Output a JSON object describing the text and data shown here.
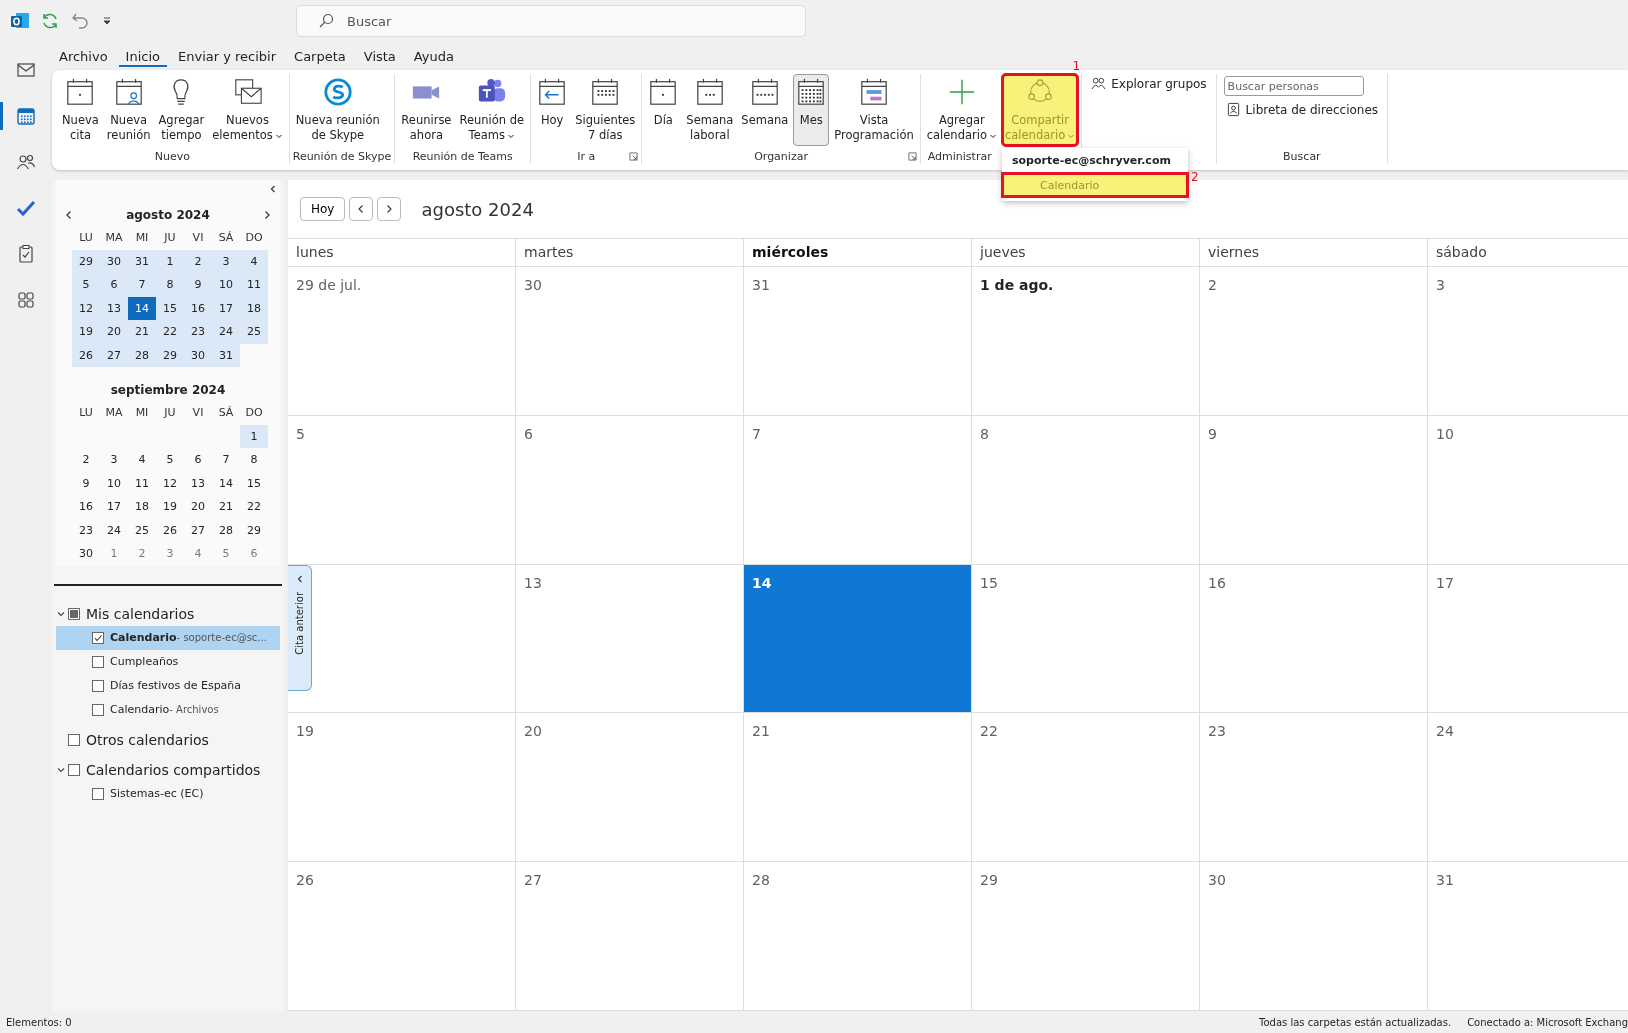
{
  "topbar": {
    "search": {
      "placeholder": "Buscar"
    }
  },
  "rail": [
    {
      "kind": "mail",
      "selected": false
    },
    {
      "kind": "calendar",
      "selected": true
    },
    {
      "kind": "people",
      "selected": false
    },
    {
      "kind": "todo",
      "selected": false
    },
    {
      "kind": "clipboard",
      "selected": false
    },
    {
      "kind": "apps",
      "selected": false
    }
  ],
  "tabs": [
    {
      "label": "Archivo",
      "selected": false
    },
    {
      "label": "Inicio",
      "selected": true
    },
    {
      "label": "Enviar y recibir",
      "selected": false
    },
    {
      "label": "Carpeta",
      "selected": false
    },
    {
      "label": "Vista",
      "selected": false
    },
    {
      "label": "Ayuda",
      "selected": false
    }
  ],
  "ribbon": {
    "groups": [
      {
        "label": "Nuevo",
        "launcher": false,
        "buttons": [
          {
            "kind": "calendar-dot",
            "lines": [
              "Nueva",
              "cita"
            ],
            "dropdown": false,
            "selected": false,
            "highlighted": false
          },
          {
            "kind": "calendar-person",
            "lines": [
              "Nueva",
              "reunión"
            ],
            "dropdown": false,
            "selected": false,
            "highlighted": false
          },
          {
            "kind": "bulb",
            "lines": [
              "Agregar",
              "tiempo"
            ],
            "dropdown": false,
            "selected": false,
            "highlighted": false
          },
          {
            "kind": "new-items",
            "lines": [
              "Nuevos",
              "elementos"
            ],
            "dropdown": true,
            "selected": false,
            "highlighted": false
          }
        ]
      },
      {
        "label": "Reunión de Skype",
        "launcher": false,
        "buttons": [
          {
            "kind": "skype",
            "lines": [
              "Nueva reunión",
              "de Skype"
            ],
            "dropdown": false,
            "selected": false,
            "highlighted": false
          }
        ]
      },
      {
        "label": "Reunión de Teams",
        "launcher": false,
        "buttons": [
          {
            "kind": "video",
            "lines": [
              "Reunirse",
              "ahora"
            ],
            "dropdown": false,
            "selected": false,
            "highlighted": false
          },
          {
            "kind": "teams",
            "lines": [
              "Reunión de",
              "Teams"
            ],
            "dropdown": true,
            "selected": false,
            "highlighted": false
          }
        ]
      },
      {
        "label": "Ir a",
        "launcher": true,
        "buttons": [
          {
            "kind": "calendar-arrow",
            "lines": [
              "Hoy"
            ],
            "dropdown": false,
            "selected": false,
            "highlighted": false
          },
          {
            "kind": "calendar-grid-small",
            "lines": [
              "Siguientes",
              "7 días"
            ],
            "dropdown": false,
            "selected": false,
            "highlighted": false
          }
        ]
      },
      {
        "label": "Organizar",
        "launcher": true,
        "buttons": [
          {
            "kind": "calendar-dot",
            "lines": [
              "Día"
            ],
            "dropdown": false,
            "selected": false,
            "highlighted": false
          },
          {
            "kind": "calendar-3dots",
            "lines": [
              "Semana",
              "laboral"
            ],
            "dropdown": false,
            "selected": false,
            "highlighted": false
          },
          {
            "kind": "calendar-5dots",
            "lines": [
              "Semana"
            ],
            "dropdown": false,
            "selected": false,
            "highlighted": false
          },
          {
            "kind": "calendar-grid",
            "lines": [
              "Mes"
            ],
            "dropdown": false,
            "selected": true,
            "highlighted": false
          },
          {
            "kind": "calendar-schedule",
            "lines": [
              "Vista",
              "Programación"
            ],
            "dropdown": false,
            "selected": false,
            "highlighted": false
          }
        ]
      },
      {
        "label": "Administrar",
        "launcher": false,
        "buttons": [
          {
            "kind": "plus",
            "lines": [
              "Agregar",
              "calendario"
            ],
            "dropdown": true,
            "selected": false,
            "highlighted": false
          },
          {
            "kind": "share",
            "lines": [
              "Compartir",
              "calendario"
            ],
            "dropdown": true,
            "selected": false,
            "highlighted": true
          }
        ]
      },
      {
        "buttons": [
          {
            "kind": "group",
            "label": "Explorar grupos"
          }
        ]
      },
      {
        "label": "Buscar",
        "launcher": false,
        "buttons": [
          {
            "kind": "field",
            "placeholder": "Buscar personas"
          },
          {
            "kind": "address-book",
            "label": "Libreta de direcciones"
          }
        ]
      }
    ]
  },
  "share_menu": {
    "header": "soporte-ec@schryver.com",
    "items": [
      {
        "label": "Calendario",
        "highlighted": true
      }
    ]
  },
  "annotations": [
    {
      "label": "1"
    },
    {
      "label": "2"
    }
  ],
  "mini_calendars": [
    {
      "title": "agosto 2024",
      "weekdays": [
        "LU",
        "MA",
        "MI",
        "JU",
        "VI",
        "SÁ",
        "DO"
      ],
      "weeks": [
        [
          {
            "d": "29",
            "in_view": true,
            "today": false,
            "muted": false
          },
          {
            "d": "30",
            "in_view": true,
            "today": false,
            "muted": false
          },
          {
            "d": "31",
            "in_view": true,
            "today": false,
            "muted": false
          },
          {
            "d": "1",
            "in_view": true,
            "today": false,
            "muted": false
          },
          {
            "d": "2",
            "in_view": true,
            "today": false,
            "muted": false
          },
          {
            "d": "3",
            "in_view": true,
            "today": false,
            "muted": false
          },
          {
            "d": "4",
            "in_view": true,
            "today": false,
            "muted": false
          }
        ],
        [
          {
            "d": "5",
            "in_view": true,
            "today": false,
            "muted": false
          },
          {
            "d": "6",
            "in_view": true,
            "today": false,
            "muted": false
          },
          {
            "d": "7",
            "in_view": true,
            "today": false,
            "muted": false
          },
          {
            "d": "8",
            "in_view": true,
            "today": false,
            "muted": false
          },
          {
            "d": "9",
            "in_view": true,
            "today": false,
            "muted": false
          },
          {
            "d": "10",
            "in_view": true,
            "today": false,
            "muted": false
          },
          {
            "d": "11",
            "in_view": true,
            "today": false,
            "muted": false
          }
        ],
        [
          {
            "d": "12",
            "in_view": true,
            "today": false,
            "muted": false
          },
          {
            "d": "13",
            "in_view": true,
            "today": false,
            "muted": false
          },
          {
            "d": "14",
            "in_view": true,
            "today": true,
            "muted": false
          },
          {
            "d": "15",
            "in_view": true,
            "today": false,
            "muted": false
          },
          {
            "d": "16",
            "in_view": true,
            "today": false,
            "muted": false
          },
          {
            "d": "17",
            "in_view": true,
            "today": false,
            "muted": false
          },
          {
            "d": "18",
            "in_view": true,
            "today": false,
            "muted": false
          }
        ],
        [
          {
            "d": "19",
            "in_view": true,
            "today": false,
            "muted": false
          },
          {
            "d": "20",
            "in_view": true,
            "today": false,
            "muted": false
          },
          {
            "d": "21",
            "in_view": true,
            "today": false,
            "muted": false
          },
          {
            "d": "22",
            "in_view": true,
            "today": false,
            "muted": false
          },
          {
            "d": "23",
            "in_view": true,
            "today": false,
            "muted": false
          },
          {
            "d": "24",
            "in_view": true,
            "today": false,
            "muted": false
          },
          {
            "d": "25",
            "in_view": true,
            "today": false,
            "muted": false
          }
        ],
        [
          {
            "d": "26",
            "in_view": true,
            "today": false,
            "muted": false
          },
          {
            "d": "27",
            "in_view": true,
            "today": false,
            "muted": false
          },
          {
            "d": "28",
            "in_view": true,
            "today": false,
            "muted": false
          },
          {
            "d": "29",
            "in_view": true,
            "today": false,
            "muted": false
          },
          {
            "d": "30",
            "in_view": true,
            "today": false,
            "muted": false
          },
          {
            "d": "31",
            "in_view": true,
            "today": false,
            "muted": false
          }
        ]
      ]
    },
    {
      "title": "septiembre 2024",
      "weekdays": [
        "LU",
        "MA",
        "MI",
        "JU",
        "VI",
        "SÁ",
        "DO"
      ],
      "weeks": [
        [
          {
            "d": "1",
            "in_view": true,
            "today": false,
            "muted": false
          }
        ],
        [
          {
            "d": "2",
            "in_view": false,
            "today": false,
            "muted": false
          },
          {
            "d": "3",
            "in_view": false,
            "today": false,
            "muted": false
          },
          {
            "d": "4",
            "in_view": false,
            "today": false,
            "muted": false
          },
          {
            "d": "5",
            "in_view": false,
            "today": false,
            "muted": false
          },
          {
            "d": "6",
            "in_view": false,
            "today": false,
            "muted": false
          },
          {
            "d": "7",
            "in_view": false,
            "today": false,
            "muted": false
          },
          {
            "d": "8",
            "in_view": false,
            "today": false,
            "muted": false
          }
        ],
        [
          {
            "d": "9",
            "in_view": false,
            "today": false,
            "muted": false
          },
          {
            "d": "10",
            "in_view": false,
            "today": false,
            "muted": false
          },
          {
            "d": "11",
            "in_view": false,
            "today": false,
            "muted": false
          },
          {
            "d": "12",
            "in_view": false,
            "today": false,
            "muted": false
          },
          {
            "d": "13",
            "in_view": false,
            "today": false,
            "muted": false
          },
          {
            "d": "14",
            "in_view": false,
            "today": false,
            "muted": false
          },
          {
            "d": "15",
            "in_view": false,
            "today": false,
            "muted": false
          }
        ],
        [
          {
            "d": "16",
            "in_view": false,
            "today": false,
            "muted": false
          },
          {
            "d": "17",
            "in_view": false,
            "today": false,
            "muted": false
          },
          {
            "d": "18",
            "in_view": false,
            "today": false,
            "muted": false
          },
          {
            "d": "19",
            "in_view": false,
            "today": false,
            "muted": false
          },
          {
            "d": "20",
            "in_view": false,
            "today": false,
            "muted": false
          },
          {
            "d": "21",
            "in_view": false,
            "today": false,
            "muted": false
          },
          {
            "d": "22",
            "in_view": false,
            "today": false,
            "muted": false
          }
        ],
        [
          {
            "d": "23",
            "in_view": false,
            "today": false,
            "muted": false
          },
          {
            "d": "24",
            "in_view": false,
            "today": false,
            "muted": false
          },
          {
            "d": "25",
            "in_view": false,
            "today": false,
            "muted": false
          },
          {
            "d": "26",
            "in_view": false,
            "today": false,
            "muted": false
          },
          {
            "d": "27",
            "in_view": false,
            "today": false,
            "muted": false
          },
          {
            "d": "28",
            "in_view": false,
            "today": false,
            "muted": false
          },
          {
            "d": "29",
            "in_view": false,
            "today": false,
            "muted": false
          }
        ],
        [
          {
            "d": "30",
            "in_view": false,
            "today": false,
            "muted": false
          },
          {
            "d": "1",
            "in_view": false,
            "today": false,
            "muted": true
          },
          {
            "d": "2",
            "in_view": false,
            "today": false,
            "muted": true
          },
          {
            "d": "3",
            "in_view": false,
            "today": false,
            "muted": true
          },
          {
            "d": "4",
            "in_view": false,
            "today": false,
            "muted": true
          },
          {
            "d": "5",
            "in_view": false,
            "today": false,
            "muted": true
          },
          {
            "d": "6",
            "in_view": false,
            "today": false,
            "muted": true
          }
        ]
      ]
    }
  ],
  "calendar_groups": [
    {
      "label": "Mis calendarios",
      "checked": false,
      "mixed": true,
      "expanded": true,
      "children": [
        {
          "name": "Calendario",
          "detail": "- soporte-ec@sc...",
          "checked": true,
          "selected": true
        },
        {
          "name": "Cumpleaños",
          "checked": false,
          "selected": false
        },
        {
          "name": "Días festivos de España",
          "checked": false,
          "selected": false
        },
        {
          "name": "Calendario",
          "detail": "- Archivos",
          "checked": false,
          "selected": false
        }
      ]
    },
    {
      "label": "Otros calendarios",
      "checked": false,
      "mixed": false
    },
    {
      "label": "Calendarios compartidos",
      "checked": false,
      "mixed": false,
      "expanded": true,
      "children": [
        {
          "name": "Sistemas-ec (EC)",
          "checked": false,
          "selected": false
        }
      ]
    }
  ],
  "calendar": {
    "today_button": "Hoy",
    "title": "agosto 2024",
    "weekdays": [
      {
        "label": "lunes",
        "current": false
      },
      {
        "label": "martes",
        "current": false
      },
      {
        "label": "miércoles",
        "current": true
      },
      {
        "label": "jueves",
        "current": false
      },
      {
        "label": "viernes",
        "current": false
      },
      {
        "label": "sábado",
        "current": false
      }
    ],
    "weeks": [
      [
        {
          "d": "29 de jul.",
          "month_start": false,
          "selected": false
        },
        {
          "d": "30",
          "month_start": false,
          "selected": false
        },
        {
          "d": "31",
          "month_start": false,
          "selected": false
        },
        {
          "d": "1 de ago.",
          "month_start": true,
          "selected": false
        },
        {
          "d": "2",
          "month_start": false,
          "selected": false
        },
        {
          "d": "3",
          "month_start": false,
          "selected": false
        }
      ],
      [
        {
          "d": "5",
          "month_start": false,
          "selected": false
        },
        {
          "d": "6",
          "month_start": false,
          "selected": false
        },
        {
          "d": "7",
          "month_start": false,
          "selected": false
        },
        {
          "d": "8",
          "month_start": false,
          "selected": false
        },
        {
          "d": "9",
          "month_start": false,
          "selected": false
        },
        {
          "d": "10",
          "month_start": false,
          "selected": false
        }
      ],
      [
        {
          "previous_tab": "Cita anterior",
          "selected": false
        },
        {
          "d": "13",
          "month_start": false,
          "selected": false
        },
        {
          "d": "14",
          "month_start": false,
          "selected": true
        },
        {
          "d": "15",
          "month_start": false,
          "selected": false
        },
        {
          "d": "16",
          "month_start": false,
          "selected": false
        },
        {
          "d": "17",
          "month_start": false,
          "selected": false
        }
      ],
      [
        {
          "d": "19",
          "month_start": false,
          "selected": false
        },
        {
          "d": "20",
          "month_start": false,
          "selected": false
        },
        {
          "d": "21",
          "month_start": false,
          "selected": false
        },
        {
          "d": "22",
          "month_start": false,
          "selected": false
        },
        {
          "d": "23",
          "month_start": false,
          "selected": false
        },
        {
          "d": "24",
          "month_start": false,
          "selected": false
        }
      ],
      [
        {
          "d": "26",
          "month_start": false,
          "selected": false
        },
        {
          "d": "27",
          "month_start": false,
          "selected": false
        },
        {
          "d": "28",
          "month_start": false,
          "selected": false
        },
        {
          "d": "29",
          "month_start": false,
          "selected": false
        },
        {
          "d": "30",
          "month_start": false,
          "selected": false
        },
        {
          "d": "31",
          "month_start": false,
          "selected": false
        }
      ]
    ]
  },
  "status_bar": {
    "left": "Elementos: 0",
    "right": [
      "Todas las carpetas están actualizadas.",
      "Conectado a: Microsoft Exchang"
    ]
  }
}
